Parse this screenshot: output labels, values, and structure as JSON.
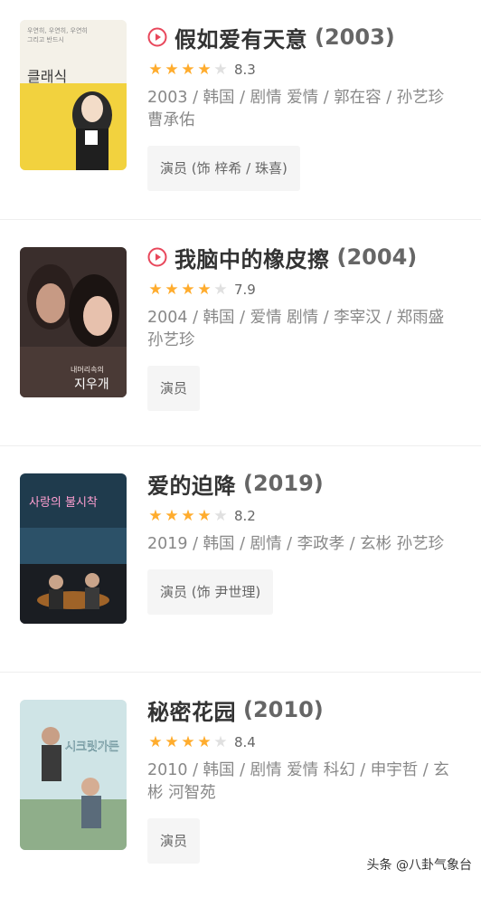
{
  "movies": [
    {
      "title": "假如爱有天意",
      "year": "(2003)",
      "has_play": true,
      "stars": 4,
      "score": "8.3",
      "meta": "2003 / 韩国 / 剧情 爱情 / 郭在容 / 孙艺珍 曹承佑",
      "role": "演员 (饰 梓希 / 珠喜)",
      "poster_icon": "poster-classic",
      "poster_text": "클래식"
    },
    {
      "title": "我脑中的橡皮擦",
      "year": "(2004)",
      "has_play": true,
      "stars": 4,
      "score": "7.9",
      "meta": "2004 / 韩国 / 爱情 剧情 / 李宰汉 / 郑雨盛 孙艺珍",
      "role": "演员",
      "poster_icon": "poster-eraser",
      "poster_text": "지우개"
    },
    {
      "title": "爱的迫降",
      "year": "(2019)",
      "has_play": false,
      "stars": 4,
      "score": "8.2",
      "meta": "2019 / 韩国 / 剧情 / 李政孝 / 玄彬 孙艺珍",
      "role": "演员 (饰 尹世理)",
      "poster_icon": "poster-crash-landing",
      "poster_text": "사랑의 불시착"
    },
    {
      "title": "秘密花园",
      "year": "(2010)",
      "has_play": false,
      "stars": 4,
      "score": "8.4",
      "meta": "2010 / 韩国 / 剧情 爱情 科幻 / 申宇哲 / 玄彬 河智苑",
      "role": "演员",
      "poster_icon": "poster-secret-garden",
      "poster_text": "시크릿가든"
    }
  ],
  "watermark": "头条 @八卦气象台",
  "colors": {
    "play": "#e8475b",
    "star_full": "#ffac2d",
    "star_empty": "#e0e0e0"
  }
}
